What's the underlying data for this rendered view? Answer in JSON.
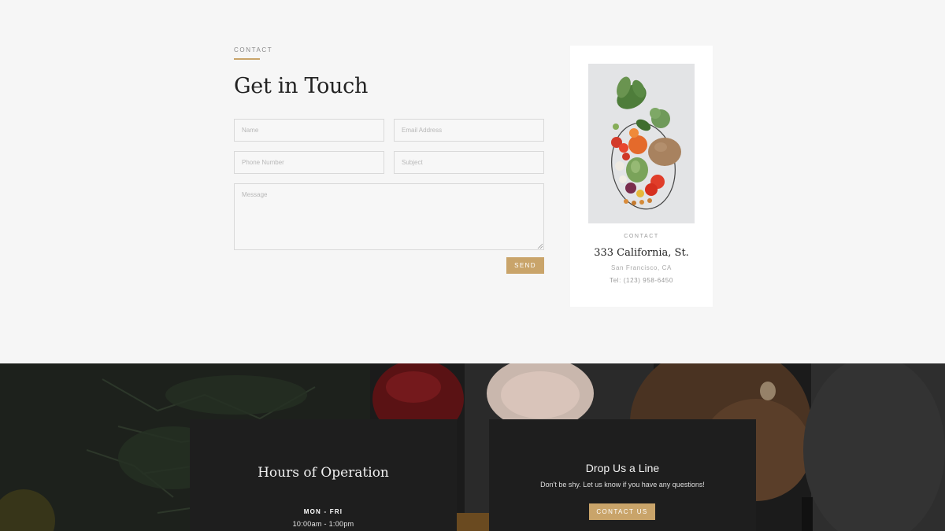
{
  "form": {
    "eyebrow": "CONTACT",
    "title": "Get in Touch",
    "name_placeholder": "Name",
    "email_placeholder": "Email Address",
    "phone_placeholder": "Phone Number",
    "subject_placeholder": "Subject",
    "message_placeholder": "Message",
    "send_label": "SEND"
  },
  "card": {
    "eyebrow": "CONTACT",
    "address": "333 California, St.",
    "city": "San Francisco, CA",
    "tel": "Tel: (123) 958-6450",
    "photo_icon": "vegetable-basket-photo"
  },
  "hours": {
    "title": "Hours of Operation",
    "days": "MON - FRI",
    "time": "10:00am - 1:00pm"
  },
  "drop_line": {
    "title": "Drop Us a Line",
    "subtitle": "Don't be shy. Let us know if you have any questions!",
    "button_label": "CONTACT US"
  },
  "colors": {
    "accent": "#c9a46a",
    "page_bg": "#f6f6f6",
    "dark_bg": "#1b1b1b",
    "panel_bg": "#1e1e1e"
  }
}
